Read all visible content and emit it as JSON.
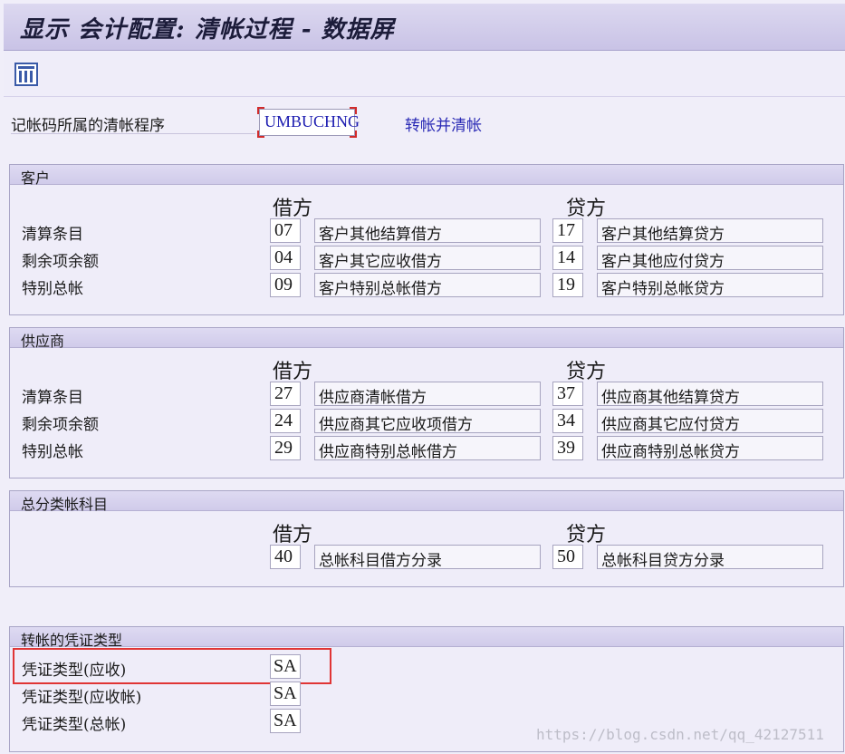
{
  "window": {
    "title": "显示 会计配置: 清帐过程 - 数据屏"
  },
  "toolbar": {
    "icon": "table-settings-icon"
  },
  "header": {
    "label": "记帐码所属的清帐程序",
    "program_value": "UMBUCHNG",
    "program_desc": "转帐并清帐"
  },
  "customer": {
    "title": "客户",
    "debit_label": "借方",
    "credit_label": "贷方",
    "rows": [
      {
        "label": "清算条目",
        "debit_key": "07",
        "debit_desc": "客户其他结算借方",
        "credit_key": "17",
        "credit_desc": "客户其他结算贷方"
      },
      {
        "label": "剩余项余额",
        "debit_key": "04",
        "debit_desc": "客户其它应收借方",
        "credit_key": "14",
        "credit_desc": "客户其他应付贷方"
      },
      {
        "label": "特别总帐",
        "debit_key": "09",
        "debit_desc": "客户特别总帐借方",
        "credit_key": "19",
        "credit_desc": "客户特别总帐贷方"
      }
    ]
  },
  "vendor": {
    "title": "供应商",
    "debit_label": "借方",
    "credit_label": "贷方",
    "rows": [
      {
        "label": "清算条目",
        "debit_key": "27",
        "debit_desc": "供应商清帐借方",
        "credit_key": "37",
        "credit_desc": "供应商其他结算贷方"
      },
      {
        "label": "剩余项余额",
        "debit_key": "24",
        "debit_desc": "供应商其它应收项借方",
        "credit_key": "34",
        "credit_desc": "供应商其它应付贷方"
      },
      {
        "label": "特别总帐",
        "debit_key": "29",
        "debit_desc": "供应商特别总帐借方",
        "credit_key": "39",
        "credit_desc": "供应商特别总帐贷方"
      }
    ]
  },
  "gl": {
    "title": "总分类帐科目",
    "debit_label": "借方",
    "credit_label": "贷方",
    "debit_key": "40",
    "debit_desc": "总帐科目借方分录",
    "credit_key": "50",
    "credit_desc": "总帐科目贷方分录"
  },
  "doc_types": {
    "title": "转帐的凭证类型",
    "rows": [
      {
        "label": "凭证类型(应收)",
        "value": "SA"
      },
      {
        "label": "凭证类型(应收帐)",
        "value": "SA"
      },
      {
        "label": "凭证类型(总帐)",
        "value": "SA"
      }
    ]
  },
  "watermark": "https://blog.csdn.net/qq_42127511",
  "colors": {
    "highlight": "#e03535",
    "link": "#2a2ab5",
    "header": "#c9c3e6"
  }
}
